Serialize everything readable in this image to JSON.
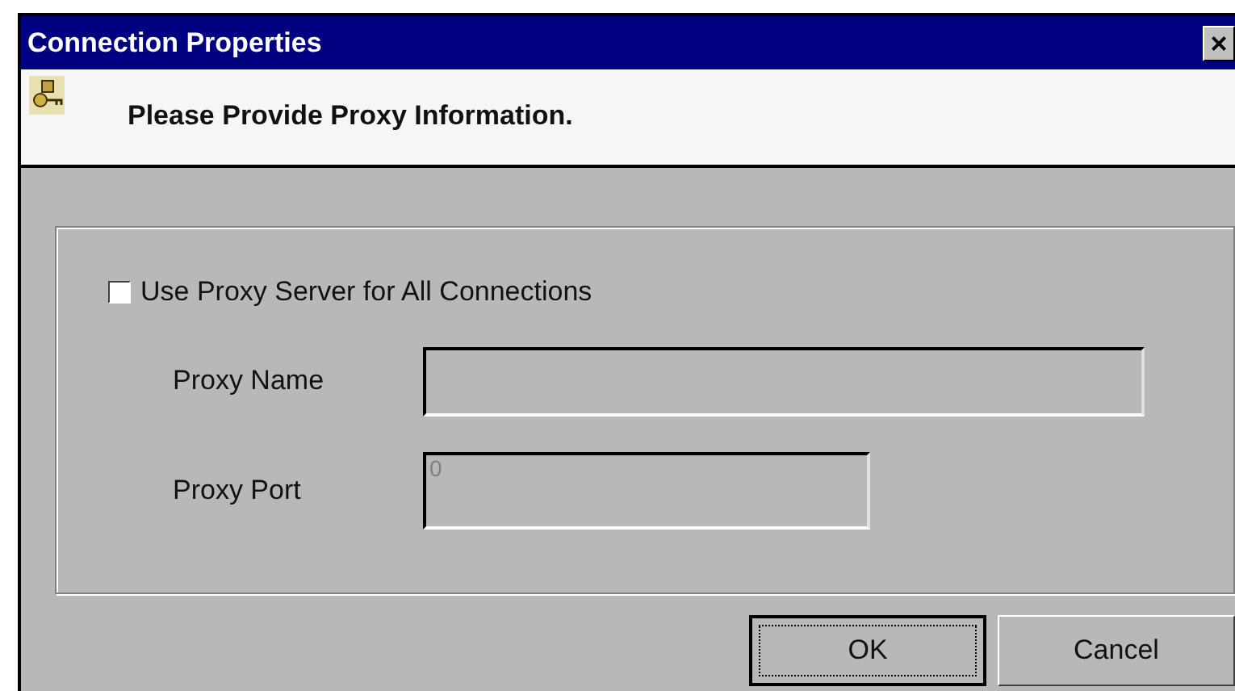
{
  "window": {
    "title": "Connection Properties",
    "close": "×"
  },
  "header": {
    "text": "Please Provide Proxy Information."
  },
  "proxy": {
    "checkbox": {
      "label": "Use Proxy Server for All Connections",
      "checked": false
    },
    "fields": [
      {
        "label": "Proxy Name",
        "disabled": true,
        "kind": "wide"
      },
      {
        "label": "Proxy Port",
        "value": "0",
        "disabled": true,
        "kind": "narrow"
      }
    ]
  },
  "buttons": [
    {
      "label": "OK",
      "default": true
    },
    {
      "label": "Cancel",
      "default": false
    }
  ]
}
